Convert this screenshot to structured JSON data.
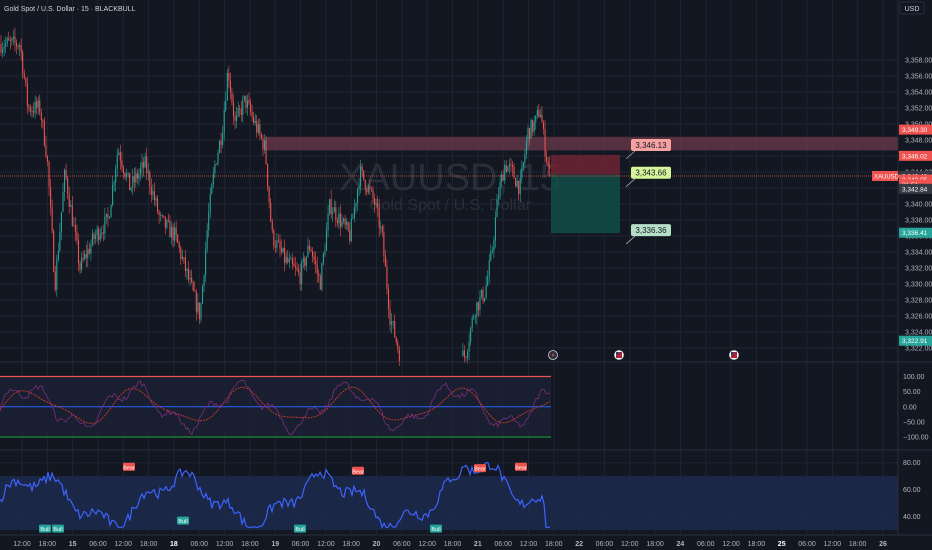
{
  "header": {
    "title": "Gold Spot / U.S. Dollar · 15 · BLACKBULL",
    "currency": "USD",
    "watermark_symbol": "XAUUSD, 15",
    "watermark_name": "Gold Spot / U.S. Dollar"
  },
  "colors": {
    "background": "#131722",
    "grid": "#1f2431",
    "bull": "#26a69a",
    "bear": "#ef5350",
    "zone": "#6b3a4c",
    "stop_box": "#6e2432",
    "target_box": "#124d46",
    "cci": "#2962ff",
    "rsi": "#3d63ff",
    "rsi_band": "#1c2a4e"
  },
  "chart_data": [
    {
      "type": "candlestick",
      "title": "Gold Spot / U.S. Dollar · 15 · BLACKBULL",
      "ylim": [
        3321,
        3363
      ],
      "y_ticks": [
        "3,358.00",
        "3,356.00",
        "3,354.00",
        "3,352.00",
        "3,350.00",
        "3,348.00",
        "3,346.00",
        "3,344.00",
        "3,342.00",
        "3,340.00",
        "3,338.00",
        "3,336.00",
        "3,334.00",
        "3,332.00",
        "3,330.00",
        "3,328.00",
        "3,326.00",
        "3,324.00",
        "3,322.00"
      ],
      "x_ticks": [
        "12:00",
        "18:00",
        "15",
        "06:00",
        "12:00",
        "18:00",
        "18",
        "06:00",
        "12:00",
        "18:00",
        "19",
        "06:00",
        "12:00",
        "18:00",
        "20",
        "06:00",
        "12:00",
        "18:00",
        "21",
        "06:00",
        "12:00",
        "18:00",
        "22",
        "06:00",
        "12:00",
        "18:00",
        "24",
        "06:00",
        "12:00",
        "18:00",
        "25",
        "06:00",
        "12:00",
        "18:00",
        "26"
      ],
      "x_ticks_bold": [
        "18",
        "25"
      ],
      "price_path": [
        [
          0,
          3360
        ],
        [
          20,
          3360
        ],
        [
          28,
          3352
        ],
        [
          40,
          3352
        ],
        [
          47,
          3346
        ],
        [
          55,
          3330
        ],
        [
          65,
          3344
        ],
        [
          80,
          3332
        ],
        [
          95,
          3336
        ],
        [
          108,
          3338
        ],
        [
          118,
          3347
        ],
        [
          130,
          3342
        ],
        [
          145,
          3345
        ],
        [
          160,
          3338
        ],
        [
          175,
          3336
        ],
        [
          190,
          3330
        ],
        [
          200,
          3326
        ],
        [
          208,
          3338
        ],
        [
          215,
          3345
        ],
        [
          222,
          3349
        ],
        [
          228,
          3357
        ],
        [
          235,
          3350
        ],
        [
          245,
          3353
        ],
        [
          255,
          3350
        ],
        [
          265,
          3347
        ],
        [
          272,
          3336
        ],
        [
          285,
          3333
        ],
        [
          300,
          3331
        ],
        [
          310,
          3335
        ],
        [
          320,
          3330
        ],
        [
          330,
          3340
        ],
        [
          340,
          3338
        ],
        [
          350,
          3336
        ],
        [
          360,
          3344
        ],
        [
          368,
          3342
        ],
        [
          375,
          3340
        ],
        [
          382,
          3336
        ],
        [
          390,
          3326
        ],
        [
          400,
          3321
        ],
        [
          440,
          3321
        ],
        [
          465,
          3321
        ],
        [
          475,
          3327
        ],
        [
          485,
          3329
        ],
        [
          492,
          3334
        ],
        [
          498,
          3341
        ],
        [
          505,
          3345
        ],
        [
          512,
          3344
        ],
        [
          520,
          3342
        ],
        [
          528,
          3349
        ],
        [
          535,
          3350
        ],
        [
          540,
          3352
        ],
        [
          545,
          3347
        ],
        [
          550,
          3343.5
        ]
      ],
      "last_price": 3343.5,
      "axis_labels": [
        {
          "text": "3,349.30",
          "price": 3349.3,
          "color": "#ef5350"
        },
        {
          "text": "3,346.02",
          "price": 3346.02,
          "color": "#ef5350"
        },
        {
          "text": "3,343.49",
          "price": 3343.49,
          "color": "#363a45"
        },
        {
          "text": "3,343.05",
          "price": 3343.05,
          "color": "#ef5350"
        },
        {
          "text": "21:51",
          "price": 3342.45,
          "color": "#ef5350"
        },
        {
          "text": "3,342.84",
          "price": 3341.9,
          "color": "#363a45"
        },
        {
          "text": "3,336.41",
          "price": 3336.41,
          "color": "#26a69a"
        },
        {
          "text": "3,322.91",
          "price": 3322.91,
          "color": "#26a69a"
        }
      ],
      "symbol_tag": "XAUUSD",
      "supply_zone": [
        3346.7,
        3348.4
      ],
      "trade": {
        "stop_label": "3,346.13",
        "stop": 3346.13,
        "entry_label": "3,343.66",
        "entry": 3343.66,
        "target_label": "3,336.36",
        "target": 3336.36
      }
    },
    {
      "type": "line",
      "name": "CCI",
      "ylim": [
        -110,
        115
      ],
      "y_ticks": [
        "100.00",
        "50.00",
        "0.00",
        "−50.00",
        "−100.00"
      ],
      "levels": [
        100,
        0,
        -100
      ]
    },
    {
      "type": "line",
      "name": "RSI",
      "ylim": [
        30,
        85
      ],
      "y_ticks": [
        "80.00",
        "60.00",
        "40.00"
      ],
      "band": [
        30,
        70
      ],
      "divergence_labels": [
        {
          "text": "Bull",
          "x": 45,
          "v": 31
        },
        {
          "text": "Bull",
          "x": 58,
          "v": 31
        },
        {
          "text": "Bear",
          "x": 129,
          "v": 77
        },
        {
          "text": "Bull",
          "x": 183,
          "v": 37
        },
        {
          "text": "Bull",
          "x": 300,
          "v": 31
        },
        {
          "text": "Bear",
          "x": 358,
          "v": 74
        },
        {
          "text": "Bull",
          "x": 436,
          "v": 31
        },
        {
          "text": "Bear",
          "x": 480,
          "v": 76
        },
        {
          "text": "Bear",
          "x": 521,
          "v": 77
        }
      ]
    }
  ],
  "events": [
    {
      "icon": "lightning-icon",
      "x": 553
    },
    {
      "icon": "us-flag-icon",
      "x": 619
    },
    {
      "icon": "us-flag-icon",
      "x": 734
    }
  ]
}
